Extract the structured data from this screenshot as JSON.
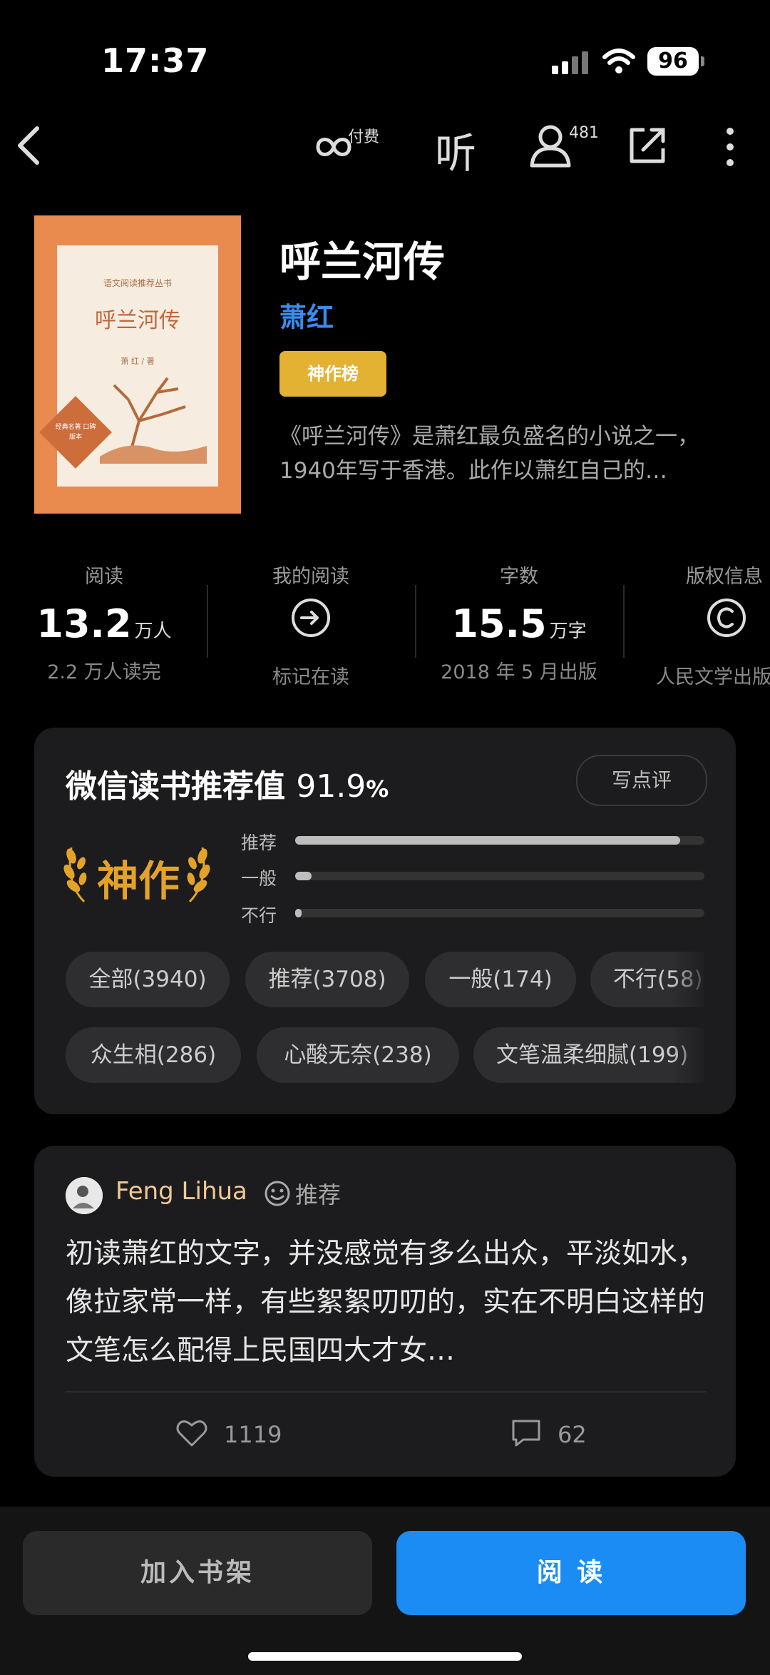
{
  "status_bar": {
    "time": "17:37",
    "battery": "96"
  },
  "nav": {
    "listen_paid": "付费",
    "listen_label": "听",
    "readers_count": "481"
  },
  "book": {
    "cover_series": "语文阅读推荐丛书",
    "cover_title": "呼兰河传",
    "cover_author": "萧 红 / 著",
    "cover_badge": "经典名著 口碑版本",
    "title": "呼兰河传",
    "author": "萧红",
    "rank_badge": "神作榜",
    "description": "《呼兰河传》是萧红最负盛名的小说之一，1940年写于香港。此作以萧红自己的…"
  },
  "stats": [
    {
      "label": "阅读",
      "value": "13.2",
      "unit": "万人",
      "sub": "2.2 万人读完"
    },
    {
      "label": "我的阅读",
      "icon": "arrow-circle-icon",
      "sub": "标记在读"
    },
    {
      "label": "字数",
      "value": "15.5",
      "unit": "万字",
      "sub": "2018 年 5 月出版"
    },
    {
      "label": "版权信息",
      "icon": "copyright-icon",
      "sub": "人民文学出版"
    }
  ],
  "rating": {
    "title": "微信读书推荐值",
    "percent": "91.9",
    "percent_sign": "%",
    "write_review": "写点评",
    "level": "神作",
    "bars": [
      {
        "label": "推荐",
        "fraction": 0.94
      },
      {
        "label": "一般",
        "fraction": 0.04
      },
      {
        "label": "不行",
        "fraction": 0.01
      }
    ],
    "filters_row1": [
      "全部(3940)",
      "推荐(3708)",
      "一般(174)",
      "不行(58)"
    ],
    "filters_row2": [
      "众生相(286)",
      "心酸无奈(238)",
      "文笔温柔细腻(199)"
    ]
  },
  "review": {
    "user": "Feng Lihua",
    "tag": "推荐",
    "text": "初读萧红的文字，并没感觉有多么出众，平淡如水，像拉家常一样，有些絮絮叨叨的，实在不明白这样的文笔怎么配得上民国四大才女…",
    "likes": "1119",
    "comments": "62"
  },
  "bottom": {
    "add_shelf": "加入书架",
    "read": "阅 读"
  },
  "colors": {
    "accent": "#1a8cf4",
    "author": "#3a8cf0",
    "gold": "#e3a32a"
  }
}
